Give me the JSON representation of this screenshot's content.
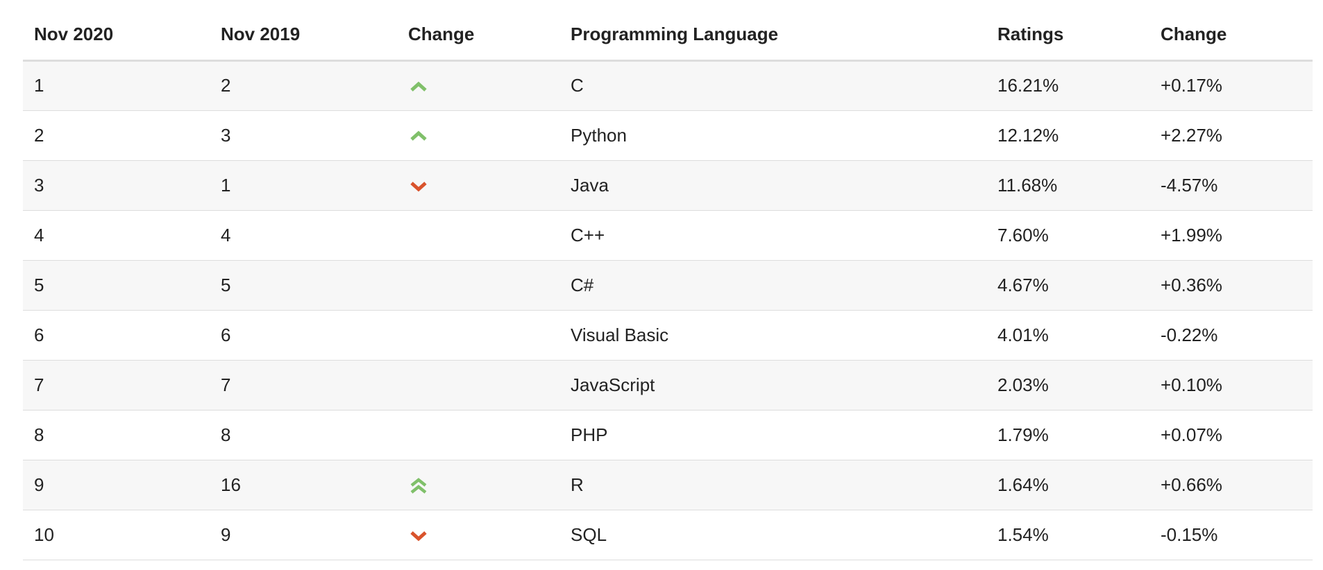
{
  "colors": {
    "up": "#80c06a",
    "down": "#d9532c",
    "row_alt": "#f7f7f7",
    "border": "#dddddd"
  },
  "table": {
    "headers": [
      "Nov 2020",
      "Nov 2019",
      "Change",
      "Programming Language",
      "Ratings",
      "Change"
    ],
    "rows": [
      {
        "now": "1",
        "prev": "2",
        "trend": "up",
        "language": "C",
        "rating": "16.21%",
        "change": "+0.17%"
      },
      {
        "now": "2",
        "prev": "3",
        "trend": "up",
        "language": "Python",
        "rating": "12.12%",
        "change": "+2.27%"
      },
      {
        "now": "3",
        "prev": "1",
        "trend": "down",
        "language": "Java",
        "rating": "11.68%",
        "change": "-4.57%"
      },
      {
        "now": "4",
        "prev": "4",
        "trend": "none",
        "language": "C++",
        "rating": "7.60%",
        "change": "+1.99%"
      },
      {
        "now": "5",
        "prev": "5",
        "trend": "none",
        "language": "C#",
        "rating": "4.67%",
        "change": "+0.36%"
      },
      {
        "now": "6",
        "prev": "6",
        "trend": "none",
        "language": "Visual Basic",
        "rating": "4.01%",
        "change": "-0.22%"
      },
      {
        "now": "7",
        "prev": "7",
        "trend": "none",
        "language": "JavaScript",
        "rating": "2.03%",
        "change": "+0.10%"
      },
      {
        "now": "8",
        "prev": "8",
        "trend": "none",
        "language": "PHP",
        "rating": "1.79%",
        "change": "+0.07%"
      },
      {
        "now": "9",
        "prev": "16",
        "trend": "up-double",
        "language": "R",
        "rating": "1.64%",
        "change": "+0.66%"
      },
      {
        "now": "10",
        "prev": "9",
        "trend": "down",
        "language": "SQL",
        "rating": "1.54%",
        "change": "-0.15%"
      }
    ]
  }
}
